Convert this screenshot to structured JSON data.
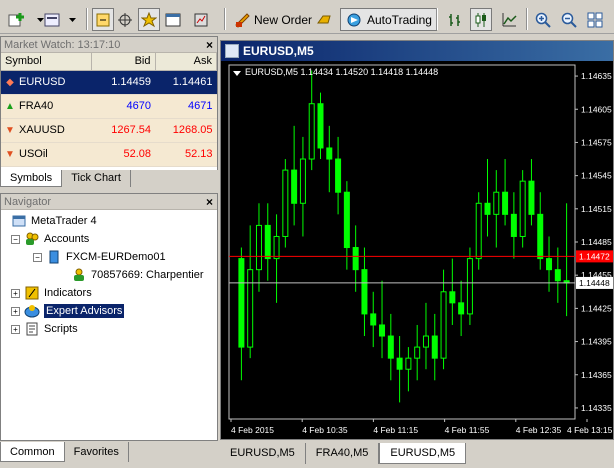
{
  "toolbar": {
    "new_order": "New Order",
    "autotrading": "AutoTrading"
  },
  "market_watch": {
    "title": "Market Watch: 13:17:10",
    "columns": [
      "Symbol",
      "Bid",
      "Ask"
    ],
    "rows": [
      {
        "symbol": "EURUSD",
        "bid": "1.14459",
        "ask": "1.14461",
        "direction": "down"
      },
      {
        "symbol": "FRA40",
        "bid": "4670",
        "ask": "4671",
        "direction": "up"
      },
      {
        "symbol": "XAUUSD",
        "bid": "1267.54",
        "ask": "1268.05",
        "direction": "down"
      },
      {
        "symbol": "USOil",
        "bid": "52.08",
        "ask": "52.13",
        "direction": "down"
      }
    ],
    "tabs": [
      "Symbols",
      "Tick Chart"
    ]
  },
  "navigator": {
    "title": "Navigator",
    "root": "MetaTrader 4",
    "accounts": "Accounts",
    "server": "FXCM-EURDemo01",
    "account": "70857669: Charpentier",
    "indicators": "Indicators",
    "expert_advisors": "Expert Advisors",
    "scripts": "Scripts",
    "tabs": [
      "Common",
      "Favorites"
    ]
  },
  "chart": {
    "window_title": "EURUSD,M5",
    "info": "EURUSD,M5  1.14434 1.14520 1.14418 1.14448",
    "price_ticks": [
      "1.14635",
      "1.14605",
      "1.14575",
      "1.14545",
      "1.14515",
      "1.14485",
      "1.14455",
      "1.14425",
      "1.14395",
      "1.14365",
      "1.14335"
    ],
    "bid_price": "1.14472",
    "last_price": "1.14448",
    "time_ticks": [
      "4 Feb 2015",
      "4 Feb 10:35",
      "4 Feb 11:15",
      "4 Feb 11:55",
      "4 Feb 12:35",
      "4 Feb 13:15"
    ],
    "colors": {
      "background": "#000000",
      "candle": "#00ff00",
      "bid_line": "#ff0000",
      "last_line": "#c0c0c0"
    }
  },
  "chart_data": {
    "type": "candlestick",
    "symbol": "EURUSD",
    "timeframe": "M5",
    "ylim": [
      1.14325,
      1.14645
    ],
    "x_labels": [
      "4 Feb 2015",
      "4 Feb 10:35",
      "4 Feb 11:15",
      "4 Feb 11:55",
      "4 Feb 12:35",
      "4 Feb 13:15"
    ],
    "candles": [
      [
        1.1447,
        1.1448,
        1.1436,
        1.1439
      ],
      [
        1.1439,
        1.145,
        1.1438,
        1.1446
      ],
      [
        1.1446,
        1.1452,
        1.1444,
        1.145
      ],
      [
        1.145,
        1.1452,
        1.1445,
        1.1447
      ],
      [
        1.1447,
        1.1451,
        1.1443,
        1.1449
      ],
      [
        1.1449,
        1.1456,
        1.1448,
        1.1455
      ],
      [
        1.1455,
        1.1459,
        1.145,
        1.1452
      ],
      [
        1.1452,
        1.1458,
        1.1449,
        1.1456
      ],
      [
        1.1456,
        1.1464,
        1.1455,
        1.1461
      ],
      [
        1.1461,
        1.1462,
        1.1456,
        1.1457
      ],
      [
        1.1457,
        1.1459,
        1.1453,
        1.1456
      ],
      [
        1.1456,
        1.1458,
        1.1451,
        1.1453
      ],
      [
        1.1453,
        1.1454,
        1.1446,
        1.1448
      ],
      [
        1.1448,
        1.145,
        1.1444,
        1.1446
      ],
      [
        1.1446,
        1.1448,
        1.144,
        1.1442
      ],
      [
        1.1442,
        1.1444,
        1.1439,
        1.1441
      ],
      [
        1.1441,
        1.1445,
        1.1438,
        1.144
      ],
      [
        1.144,
        1.1442,
        1.1436,
        1.1438
      ],
      [
        1.1438,
        1.144,
        1.1434,
        1.1437
      ],
      [
        1.1437,
        1.1439,
        1.1435,
        1.1438
      ],
      [
        1.1438,
        1.1441,
        1.1436,
        1.1439
      ],
      [
        1.1439,
        1.1443,
        1.1437,
        1.144
      ],
      [
        1.144,
        1.1442,
        1.1436,
        1.1438
      ],
      [
        1.1438,
        1.1446,
        1.1437,
        1.1444
      ],
      [
        1.1444,
        1.1447,
        1.1441,
        1.1443
      ],
      [
        1.1443,
        1.1445,
        1.144,
        1.1442
      ],
      [
        1.1442,
        1.1448,
        1.1441,
        1.1447
      ],
      [
        1.1447,
        1.1453,
        1.1446,
        1.1452
      ],
      [
        1.1452,
        1.1456,
        1.1449,
        1.1451
      ],
      [
        1.1451,
        1.1455,
        1.1448,
        1.1453
      ],
      [
        1.1453,
        1.1456,
        1.145,
        1.1451
      ],
      [
        1.1451,
        1.1453,
        1.1447,
        1.1449
      ],
      [
        1.1449,
        1.1455,
        1.1448,
        1.1454
      ],
      [
        1.1454,
        1.1456,
        1.145,
        1.1451
      ],
      [
        1.1451,
        1.1453,
        1.1446,
        1.1447
      ],
      [
        1.1447,
        1.1449,
        1.1444,
        1.1446
      ],
      [
        1.1446,
        1.1448,
        1.1443,
        1.1445
      ],
      [
        1.1445,
        1.1452,
        1.14418,
        1.14448
      ]
    ]
  }
}
